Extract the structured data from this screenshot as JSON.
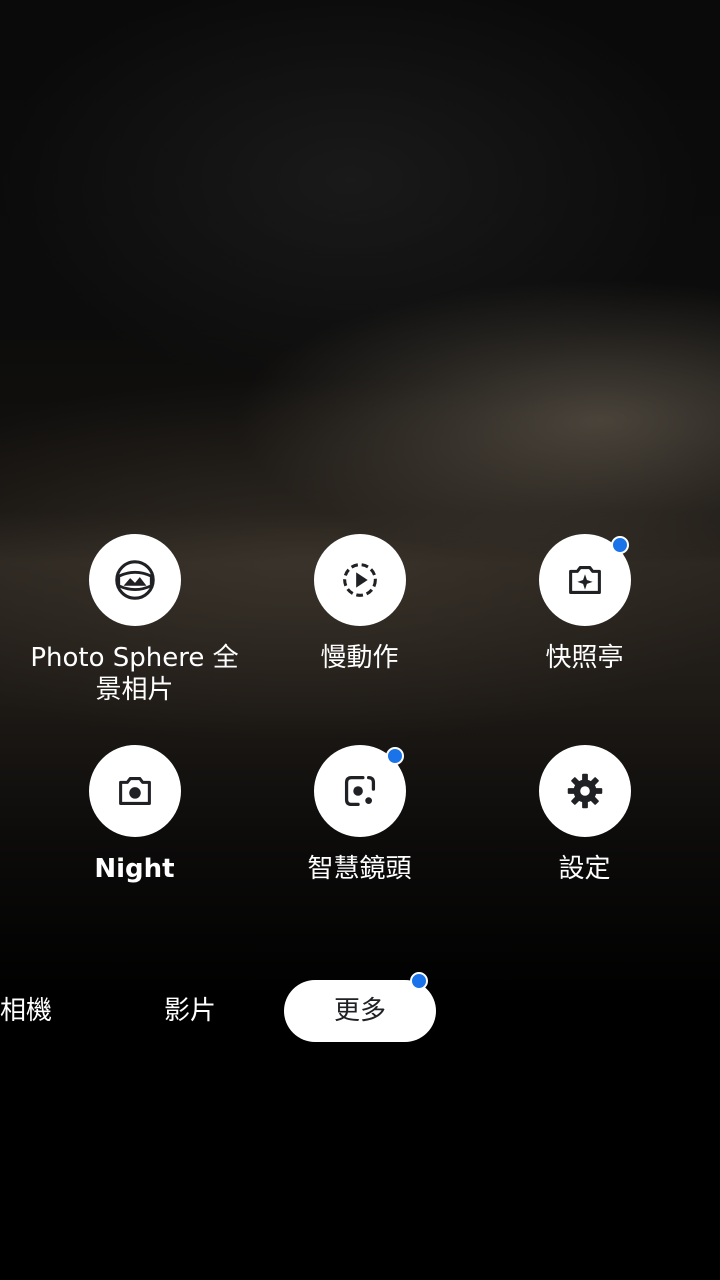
{
  "modes": [
    {
      "label": "Photo Sphere 全景相片",
      "icon": "photo-sphere-icon",
      "badge": false
    },
    {
      "label": "慢動作",
      "icon": "slow-motion-icon",
      "badge": false
    },
    {
      "label": "快照亭",
      "icon": "photobooth-icon",
      "badge": true
    },
    {
      "label": "Night",
      "icon": "night-sight-icon",
      "badge": false
    },
    {
      "label": "智慧鏡頭",
      "icon": "lens-icon",
      "badge": true
    },
    {
      "label": "設定",
      "icon": "gear-icon",
      "badge": false
    }
  ],
  "bottom_tabs": [
    {
      "label": "相機",
      "active": false
    },
    {
      "label": "影片",
      "active": false
    },
    {
      "label": "更多",
      "active": true,
      "badge": true
    }
  ],
  "colors": {
    "badge": "#1a73e8",
    "icon": "#202124",
    "circle": "#ffffff"
  }
}
